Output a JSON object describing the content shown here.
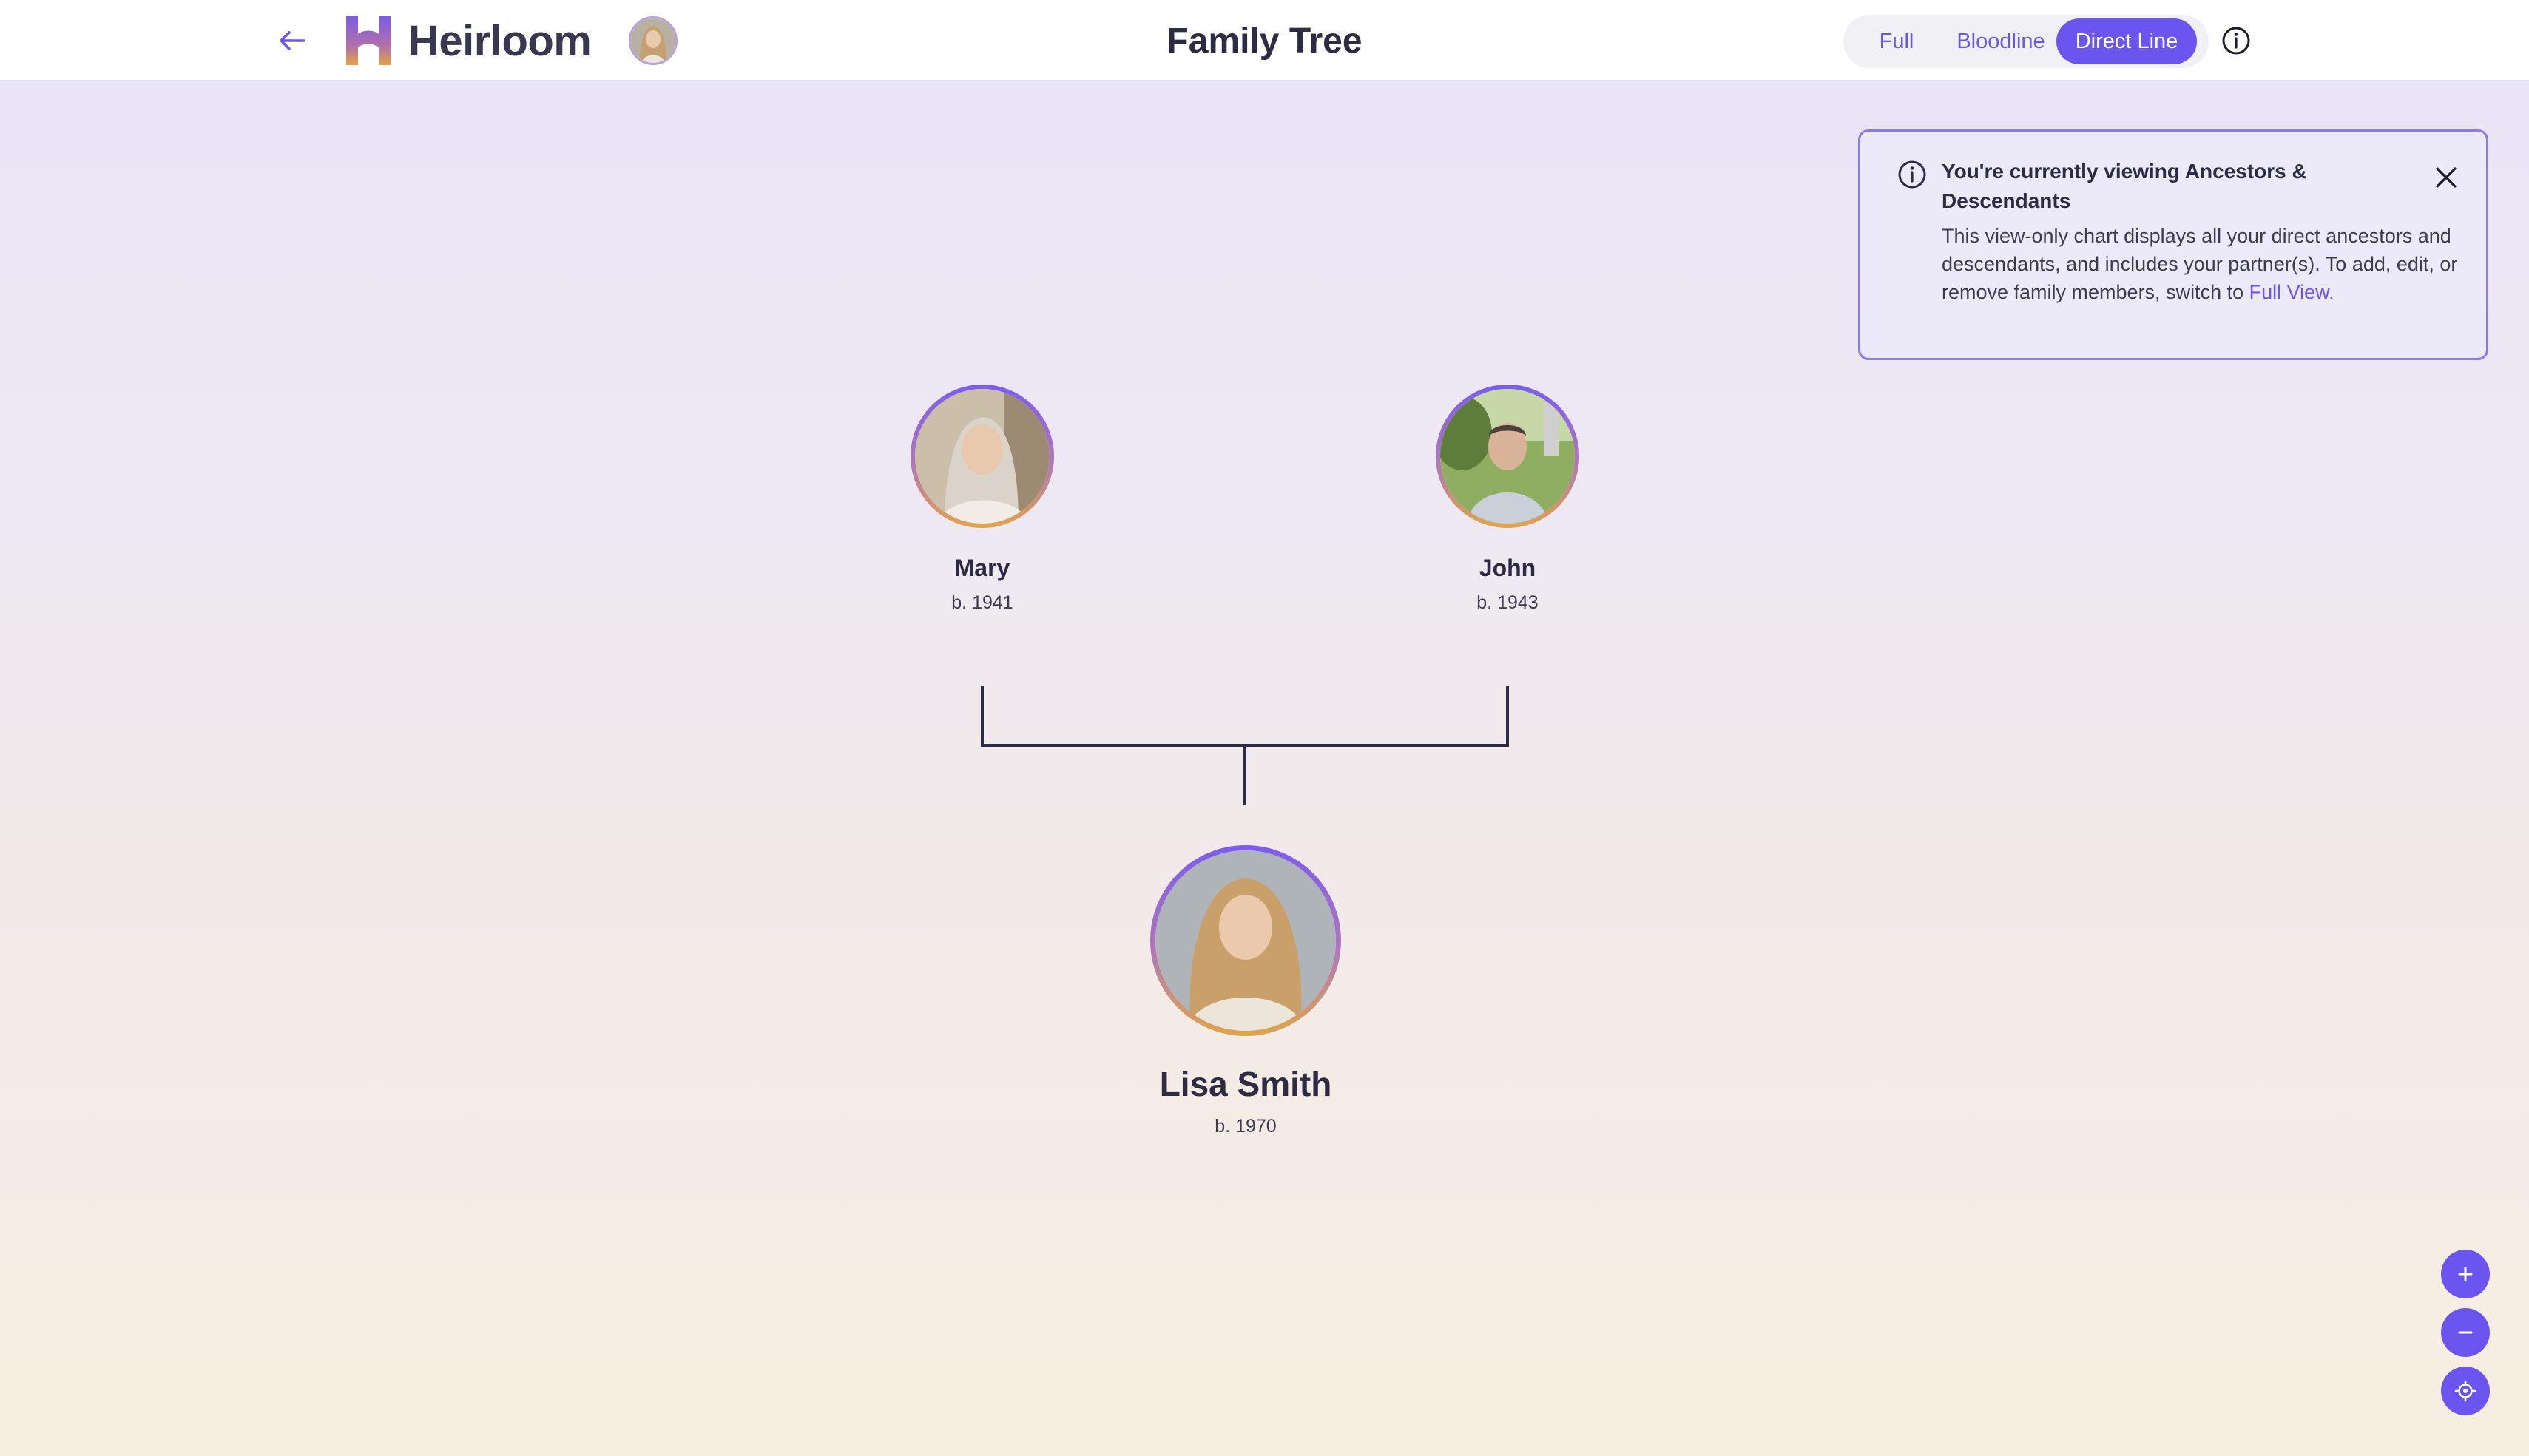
{
  "header": {
    "brand": "Heirloom",
    "title": "Family Tree",
    "view_options": [
      "Full",
      "Bloodline",
      "Direct Line"
    ],
    "active_view": "Direct Line"
  },
  "info_panel": {
    "title": "You're currently viewing Ancestors & Descendants",
    "body": "This view-only chart displays all your direct ancestors and descendants, and includes your partner(s). To add, edit, or remove family members, switch to ",
    "link": "Full View."
  },
  "tree": {
    "parents": [
      {
        "name": "Mary",
        "born": "b. 1941"
      },
      {
        "name": "John",
        "born": "b. 1943"
      }
    ],
    "root": {
      "name": "Lisa Smith",
      "born": "b. 1970"
    }
  },
  "icons": {
    "back": "arrow-left-icon",
    "info": "info-icon",
    "close": "close-icon",
    "zoom_in": "plus-icon",
    "zoom_out": "minus-icon",
    "recenter": "target-icon"
  },
  "colors": {
    "accent": "#6b55ee",
    "text": "#2e2c45"
  }
}
